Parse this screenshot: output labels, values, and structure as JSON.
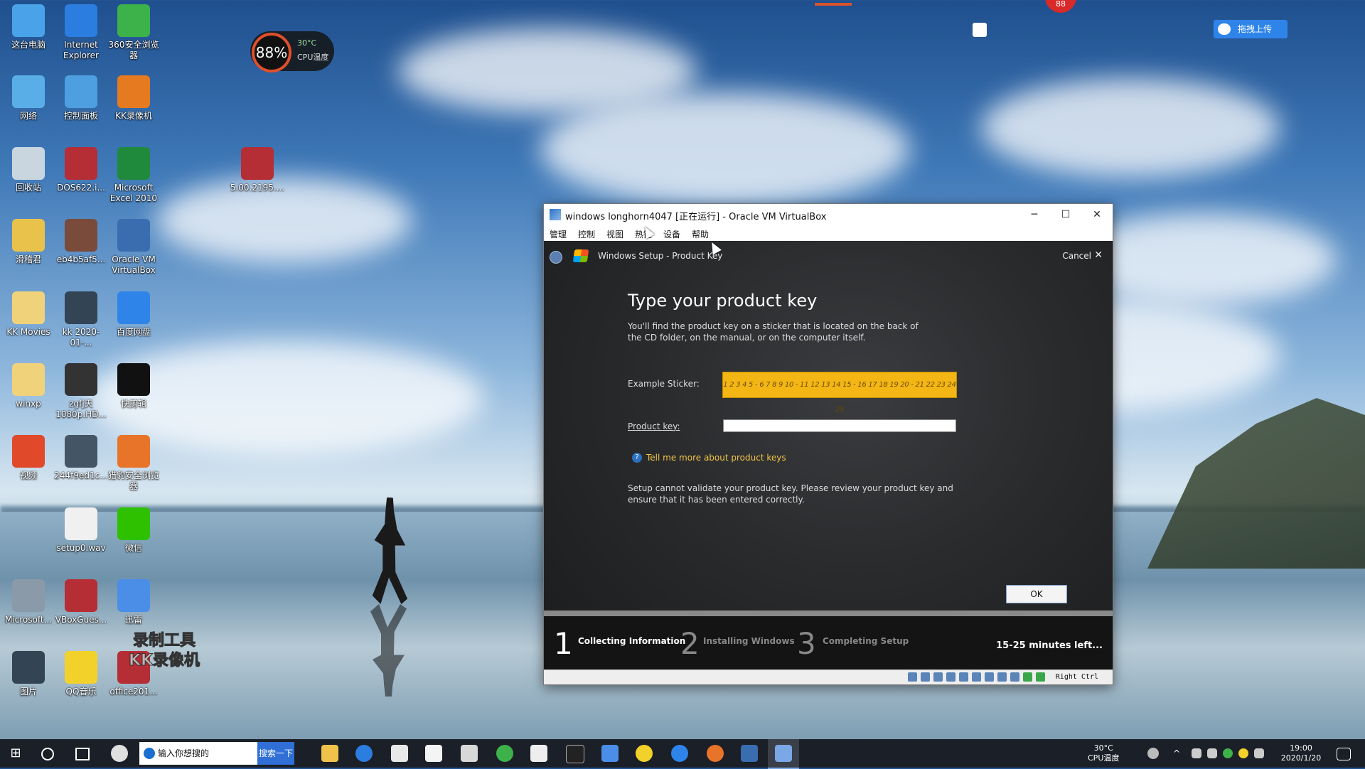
{
  "desktop": {
    "icons": [
      {
        "label": "这台电脑",
        "color": "#4aa3e8"
      },
      {
        "label": "Internet Explorer",
        "color": "#2b7de0"
      },
      {
        "label": "360安全浏览器",
        "color": "#3db24a"
      },
      {
        "label": "网络",
        "color": "#5aaee8"
      },
      {
        "label": "控制面板",
        "color": "#4d9fe0"
      },
      {
        "label": "KK录像机",
        "color": "#e67a20"
      },
      {
        "label": "回收站",
        "color": "#c9d6df"
      },
      {
        "label": "DOS622.i...",
        "color": "#b52d35"
      },
      {
        "label": "Microsoft Excel 2010",
        "color": "#1f8a3c"
      },
      {
        "label": "5.00.2195....",
        "color": "#b52d35"
      },
      {
        "label": "滑稽君",
        "color": "#e8c24a"
      },
      {
        "label": "eb4b5af5...",
        "color": "#7a4b3a"
      },
      {
        "label": "Oracle VM VirtualBox",
        "color": "#3a6db0"
      },
      {
        "label": "KK Movies",
        "color": "#f0d27a"
      },
      {
        "label": "kk 2020-01-...",
        "color": "#334455"
      },
      {
        "label": "百度网盘",
        "color": "#2f84ea"
      },
      {
        "label": "winxp",
        "color": "#f0d27a"
      },
      {
        "label": "zgfj天 1080p.HD...",
        "color": "#333"
      },
      {
        "label": "快剪辑",
        "color": "#111"
      },
      {
        "label": "视频",
        "color": "#e04a2a"
      },
      {
        "label": "244f9ed1c...",
        "color": "#445566"
      },
      {
        "label": "猎豹安全浏览器",
        "color": "#e8742a"
      },
      {
        "label": "setup0.wav",
        "color": "#f0f0f0"
      },
      {
        "label": "微信",
        "color": "#2dc100"
      },
      {
        "label": "Microsoft...",
        "color": "#8a9aa8"
      },
      {
        "label": "VBoxGues...",
        "color": "#b52d35"
      },
      {
        "label": "迅雷",
        "color": "#4a8ee8"
      },
      {
        "label": "图片",
        "color": "#334455"
      },
      {
        "label": "QQ音乐",
        "color": "#f2d22a"
      },
      {
        "label": "office201...",
        "color": "#b52d35"
      }
    ],
    "watermark": "录制工具 KK录像机"
  },
  "gadget": {
    "percent": "88%",
    "temp": "30°C",
    "label": "CPU温度"
  },
  "baidu_button": "拖拽上传",
  "red_badge": "88",
  "window": {
    "title": "windows longhorn4047 [正在运行] - Oracle VM VirtualBox",
    "buttons": {
      "minimize": "─",
      "maximize": "☐",
      "close": "✕"
    },
    "menu": [
      "管理",
      "控制",
      "视图",
      "热键",
      "设备",
      "帮助"
    ],
    "setup": {
      "header": "Windows Setup - Product Key",
      "cancel": "Cancel",
      "heading": "Type your product key",
      "description": "You'll find the product key on a sticker that is located on the back of the CD folder, on the manual, or on the computer itself.",
      "example_label": "Example Sticker:",
      "example_value": "1 2 3 4 5 - 6 7 8 9 10 - 11 12 13 14 15 - 16 17 18 19 20 - 21 22 23 24 25",
      "product_key_label": "Product key:",
      "product_key_value": "",
      "help_link": "Tell me more about product keys",
      "error": "Setup cannot validate your product key.  Please review your product key and ensure that it has been entered correctly.",
      "ok": "OK",
      "steps": [
        {
          "num": "1",
          "label": "Collecting Information",
          "active": true
        },
        {
          "num": "2",
          "label": "Installing Windows",
          "active": false
        },
        {
          "num": "3",
          "label": "Completing Setup",
          "active": false
        }
      ],
      "time_left": "15-25 minutes left..."
    },
    "statusbar_text": "Right Ctrl"
  },
  "taskbar": {
    "search_placeholder": "输入你想搜的",
    "search_button": "搜索一下",
    "tray_temp": "30°C",
    "tray_temp_label": "CPU温度",
    "time": "19:00",
    "date": "2020/1/20"
  }
}
